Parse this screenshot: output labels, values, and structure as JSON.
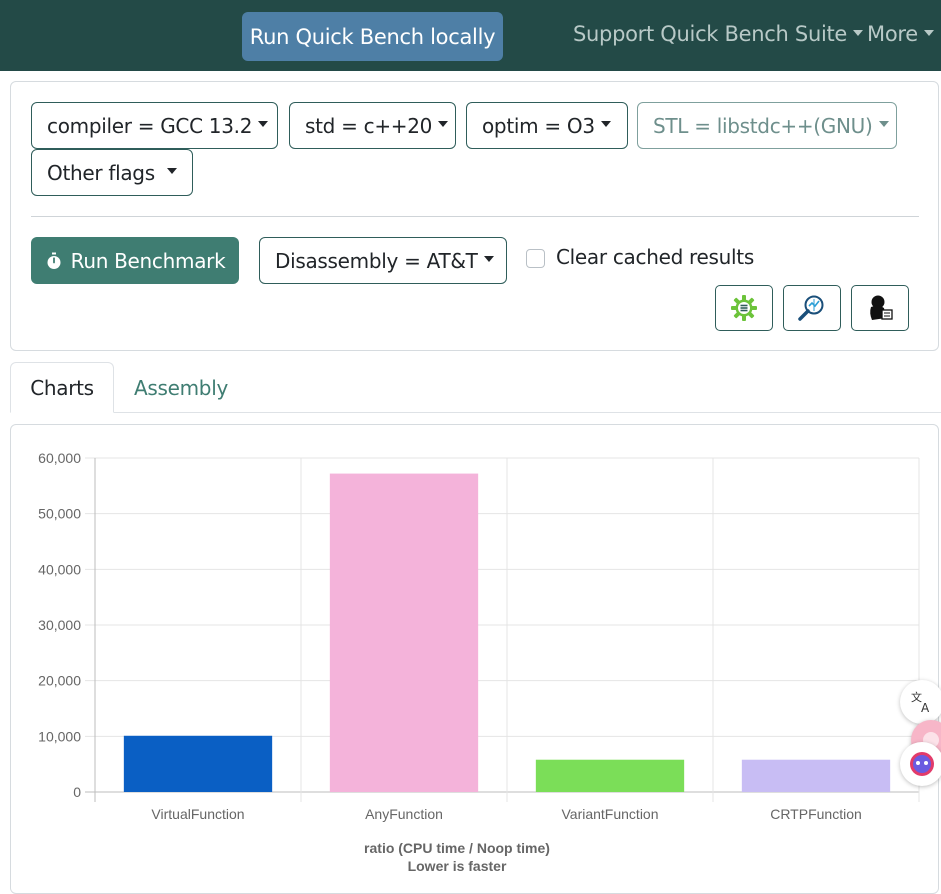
{
  "navbar": {
    "run_locally": "Run Quick Bench locally",
    "support": "Support Quick Bench Suite",
    "more": "More"
  },
  "options": {
    "compiler": "compiler = GCC 13.2",
    "std": "std = c++20",
    "optim": "optim = O3",
    "stl": "STL = libstdc++(GNU)",
    "other_flags": "Other flags",
    "run_benchmark": "Run Benchmark",
    "disassembly": "Disassembly = AT&T",
    "clear_cache_label": "Clear cached results",
    "clear_cache_checked": false
  },
  "tabs": [
    {
      "label": "Charts",
      "active": true
    },
    {
      "label": "Assembly",
      "active": false
    }
  ],
  "colors": {
    "navbar": "#234a47",
    "accent": "#3f7d72",
    "run_local": "#4e7fa6"
  },
  "chart_data": {
    "type": "bar",
    "categories": [
      "VirtualFunction",
      "AnyFunction",
      "VariantFunction",
      "CRTPFunction"
    ],
    "values": [
      10100,
      57200,
      5800,
      5800
    ],
    "colors": [
      "#0a5fc4",
      "#f4b3da",
      "#7bde58",
      "#c8bdf4"
    ],
    "ylim": [
      0,
      60000
    ],
    "yticks": [
      "0",
      "10,000",
      "20,000",
      "30,000",
      "40,000",
      "50,000",
      "60,000"
    ],
    "xlabel": "ratio (CPU time / Noop time)",
    "xlabel2": "Lower is faster",
    "ylabel": "",
    "grid": true
  }
}
